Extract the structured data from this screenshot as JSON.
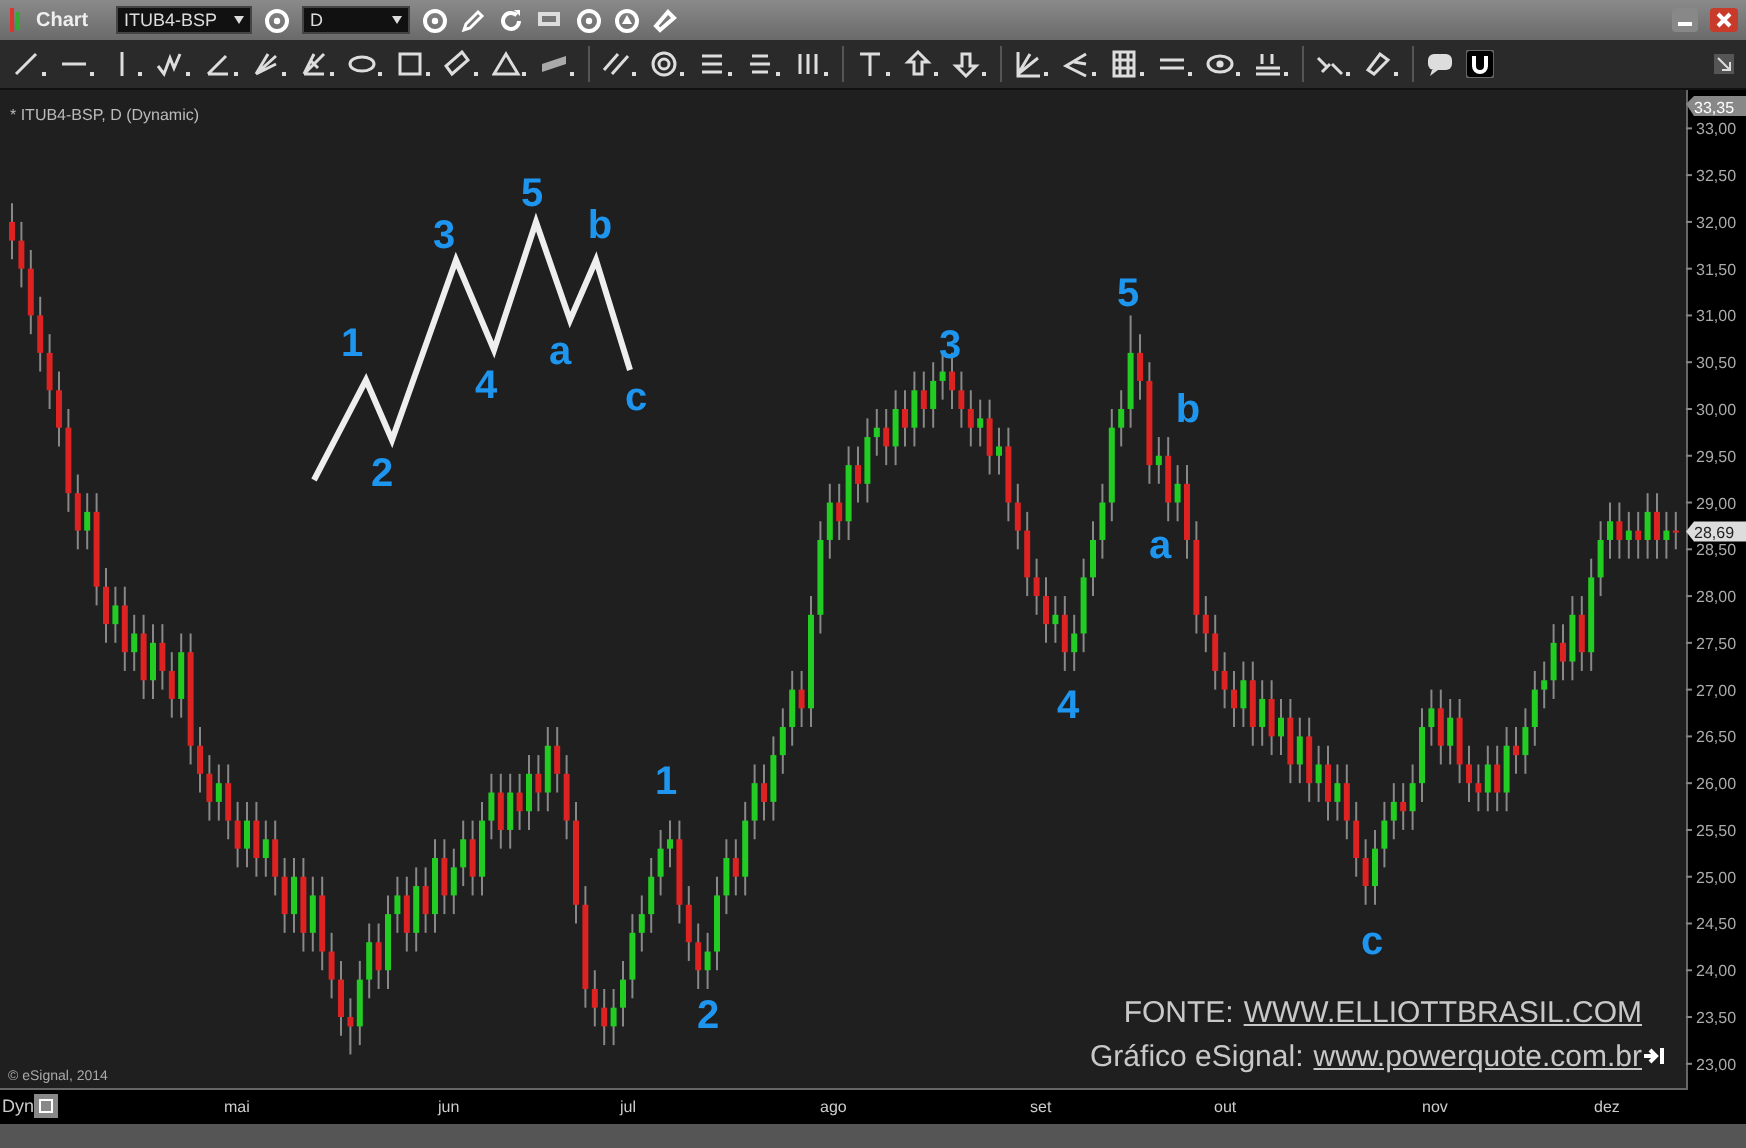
{
  "window": {
    "title": "Chart"
  },
  "toolbar": {
    "symbol": "ITUB4-BSP",
    "interval": "D"
  },
  "chart": {
    "legend": "* ITUB4-BSP, D (Dynamic)",
    "top_price": "33,35",
    "last_price": "28,69",
    "x_axis_labels": [
      "mai",
      "jun",
      "jul",
      "ago",
      "set",
      "out",
      "nov",
      "dez"
    ],
    "chart_data": {
      "type": "candlestick",
      "ylim": [
        22.72,
        33.41
      ],
      "yticks": [
        {
          "value": 33,
          "label": "33,00"
        },
        {
          "value": 32.5,
          "label": "32,50"
        },
        {
          "value": 32,
          "label": "32,00"
        },
        {
          "value": 31.5,
          "label": "31,50"
        },
        {
          "value": 31,
          "label": "31,00"
        },
        {
          "value": 30.5,
          "label": "30,50"
        },
        {
          "value": 30,
          "label": "30,00"
        },
        {
          "value": 29.5,
          "label": "29,50"
        },
        {
          "value": 29,
          "label": "29,00"
        },
        {
          "value": 28.5,
          "label": "28,50"
        },
        {
          "value": 28,
          "label": "28,00"
        },
        {
          "value": 27.5,
          "label": "27,50"
        },
        {
          "value": 27,
          "label": "27,00"
        },
        {
          "value": 26.5,
          "label": "26,50"
        },
        {
          "value": 26,
          "label": "26,00"
        },
        {
          "value": 25.5,
          "label": "25,50"
        },
        {
          "value": 25,
          "label": "25,00"
        },
        {
          "value": 24.5,
          "label": "24,50"
        },
        {
          "value": 24,
          "label": "24,00"
        },
        {
          "value": 23.5,
          "label": "23,50"
        },
        {
          "value": 23,
          "label": "23,00"
        }
      ],
      "ohlc": [
        [
          32.0,
          32.2,
          31.6,
          31.8
        ],
        [
          31.8,
          32.0,
          31.3,
          31.5
        ],
        [
          31.5,
          31.7,
          30.8,
          31.0
        ],
        [
          31.0,
          31.2,
          30.4,
          30.6
        ],
        [
          30.6,
          30.8,
          30.0,
          30.2
        ],
        [
          30.2,
          30.4,
          29.6,
          29.8
        ],
        [
          29.8,
          30.0,
          28.9,
          29.1
        ],
        [
          29.1,
          29.3,
          28.5,
          28.7
        ],
        [
          28.7,
          29.1,
          28.5,
          28.9
        ],
        [
          28.9,
          29.1,
          27.9,
          28.1
        ],
        [
          28.1,
          28.3,
          27.5,
          27.7
        ],
        [
          27.7,
          28.1,
          27.5,
          27.9
        ],
        [
          27.9,
          28.1,
          27.2,
          27.4
        ],
        [
          27.4,
          27.8,
          27.2,
          27.6
        ],
        [
          27.6,
          27.8,
          26.9,
          27.1
        ],
        [
          27.1,
          27.7,
          26.9,
          27.5
        ],
        [
          27.5,
          27.7,
          27.0,
          27.2
        ],
        [
          27.2,
          27.4,
          26.7,
          26.9
        ],
        [
          26.9,
          27.6,
          26.7,
          27.4
        ],
        [
          27.4,
          27.6,
          26.2,
          26.4
        ],
        [
          26.4,
          26.6,
          25.9,
          26.1
        ],
        [
          26.1,
          26.3,
          25.6,
          25.8
        ],
        [
          25.8,
          26.2,
          25.6,
          26.0
        ],
        [
          26.0,
          26.2,
          25.4,
          25.6
        ],
        [
          25.6,
          25.8,
          25.1,
          25.3
        ],
        [
          25.3,
          25.8,
          25.1,
          25.6
        ],
        [
          25.6,
          25.8,
          25.0,
          25.2
        ],
        [
          25.2,
          25.6,
          25.0,
          25.4
        ],
        [
          25.4,
          25.6,
          24.8,
          25.0
        ],
        [
          25.0,
          25.2,
          24.4,
          24.6
        ],
        [
          24.6,
          25.2,
          24.4,
          25.0
        ],
        [
          25.0,
          25.2,
          24.2,
          24.4
        ],
        [
          24.4,
          25.0,
          24.2,
          24.8
        ],
        [
          24.8,
          25.0,
          24.0,
          24.2
        ],
        [
          24.2,
          24.4,
          23.7,
          23.9
        ],
        [
          23.9,
          24.1,
          23.3,
          23.5
        ],
        [
          23.5,
          23.7,
          23.1,
          23.4
        ],
        [
          23.4,
          24.1,
          23.2,
          23.9
        ],
        [
          23.9,
          24.5,
          23.7,
          24.3
        ],
        [
          24.3,
          24.5,
          23.8,
          24.0
        ],
        [
          24.0,
          24.8,
          23.8,
          24.6
        ],
        [
          24.6,
          25.0,
          24.4,
          24.8
        ],
        [
          24.8,
          25.0,
          24.2,
          24.4
        ],
        [
          24.4,
          25.1,
          24.2,
          24.9
        ],
        [
          24.9,
          25.1,
          24.4,
          24.6
        ],
        [
          24.6,
          25.4,
          24.4,
          25.2
        ],
        [
          25.2,
          25.4,
          24.6,
          24.8
        ],
        [
          24.8,
          25.3,
          24.6,
          25.1
        ],
        [
          25.1,
          25.6,
          24.9,
          25.4
        ],
        [
          25.4,
          25.6,
          24.8,
          25.0
        ],
        [
          25.0,
          25.8,
          24.8,
          25.6
        ],
        [
          25.6,
          26.1,
          25.4,
          25.9
        ],
        [
          25.9,
          26.1,
          25.3,
          25.5
        ],
        [
          25.5,
          26.1,
          25.3,
          25.9
        ],
        [
          25.9,
          26.1,
          25.5,
          25.7
        ],
        [
          25.7,
          26.3,
          25.5,
          26.1
        ],
        [
          26.1,
          26.3,
          25.7,
          25.9
        ],
        [
          25.9,
          26.6,
          25.7,
          26.4
        ],
        [
          26.4,
          26.6,
          25.9,
          26.1
        ],
        [
          26.1,
          26.3,
          25.4,
          25.6
        ],
        [
          25.6,
          25.8,
          24.5,
          24.7
        ],
        [
          24.7,
          24.9,
          23.6,
          23.8
        ],
        [
          23.8,
          24.0,
          23.4,
          23.6
        ],
        [
          23.6,
          23.8,
          23.2,
          23.4
        ],
        [
          23.4,
          23.8,
          23.2,
          23.6
        ],
        [
          23.6,
          24.1,
          23.4,
          23.9
        ],
        [
          23.9,
          24.6,
          23.7,
          24.4
        ],
        [
          24.4,
          24.8,
          24.2,
          24.6
        ],
        [
          24.6,
          25.2,
          24.4,
          25.0
        ],
        [
          25.0,
          25.5,
          24.8,
          25.3
        ],
        [
          25.3,
          25.6,
          25.1,
          25.4
        ],
        [
          25.4,
          25.6,
          24.5,
          24.7
        ],
        [
          24.7,
          24.9,
          24.1,
          24.3
        ],
        [
          24.3,
          24.5,
          23.8,
          24.0
        ],
        [
          24.0,
          24.4,
          23.8,
          24.2
        ],
        [
          24.2,
          25.0,
          24.0,
          24.8
        ],
        [
          24.8,
          25.4,
          24.6,
          25.2
        ],
        [
          25.2,
          25.4,
          24.8,
          25.0
        ],
        [
          25.0,
          25.8,
          24.8,
          25.6
        ],
        [
          25.6,
          26.2,
          25.4,
          26.0
        ],
        [
          26.0,
          26.2,
          25.6,
          25.8
        ],
        [
          25.8,
          26.5,
          25.6,
          26.3
        ],
        [
          26.3,
          26.8,
          26.1,
          26.6
        ],
        [
          26.6,
          27.2,
          26.4,
          27.0
        ],
        [
          27.0,
          27.2,
          26.6,
          26.8
        ],
        [
          26.8,
          28.0,
          26.6,
          27.8
        ],
        [
          27.8,
          28.8,
          27.6,
          28.6
        ],
        [
          28.6,
          29.2,
          28.4,
          29.0
        ],
        [
          29.0,
          29.2,
          28.6,
          28.8
        ],
        [
          28.8,
          29.6,
          28.6,
          29.4
        ],
        [
          29.4,
          29.6,
          29.0,
          29.2
        ],
        [
          29.2,
          29.9,
          29.0,
          29.7
        ],
        [
          29.7,
          30.0,
          29.5,
          29.8
        ],
        [
          29.8,
          30.0,
          29.4,
          29.6
        ],
        [
          29.6,
          30.2,
          29.4,
          30.0
        ],
        [
          30.0,
          30.2,
          29.6,
          29.8
        ],
        [
          29.8,
          30.4,
          29.6,
          30.2
        ],
        [
          30.2,
          30.4,
          29.8,
          30.0
        ],
        [
          30.0,
          30.5,
          29.8,
          30.3
        ],
        [
          30.3,
          30.6,
          30.1,
          30.4
        ],
        [
          30.4,
          30.6,
          30.0,
          30.2
        ],
        [
          30.2,
          30.4,
          29.8,
          30.0
        ],
        [
          30.0,
          30.2,
          29.6,
          29.8
        ],
        [
          29.8,
          30.1,
          29.6,
          29.9
        ],
        [
          29.9,
          30.1,
          29.3,
          29.5
        ],
        [
          29.5,
          29.8,
          29.3,
          29.6
        ],
        [
          29.6,
          29.8,
          28.8,
          29.0
        ],
        [
          29.0,
          29.2,
          28.5,
          28.7
        ],
        [
          28.7,
          28.9,
          28.0,
          28.2
        ],
        [
          28.2,
          28.4,
          27.8,
          28.0
        ],
        [
          28.0,
          28.2,
          27.5,
          27.7
        ],
        [
          27.7,
          28.0,
          27.5,
          27.8
        ],
        [
          27.8,
          28.0,
          27.2,
          27.4
        ],
        [
          27.4,
          27.8,
          27.2,
          27.6
        ],
        [
          27.6,
          28.4,
          27.4,
          28.2
        ],
        [
          28.2,
          28.8,
          28.0,
          28.6
        ],
        [
          28.6,
          29.2,
          28.4,
          29.0
        ],
        [
          29.0,
          30.0,
          28.8,
          29.8
        ],
        [
          29.8,
          30.2,
          29.6,
          30.0
        ],
        [
          30.0,
          31.0,
          29.8,
          30.6
        ],
        [
          30.6,
          30.8,
          30.1,
          30.3
        ],
        [
          30.3,
          30.5,
          29.2,
          29.4
        ],
        [
          29.4,
          29.7,
          29.2,
          29.5
        ],
        [
          29.5,
          29.7,
          28.8,
          29.0
        ],
        [
          29.0,
          29.4,
          28.8,
          29.2
        ],
        [
          29.2,
          29.4,
          28.4,
          28.6
        ],
        [
          28.6,
          28.8,
          27.6,
          27.8
        ],
        [
          27.8,
          28.0,
          27.4,
          27.6
        ],
        [
          27.6,
          27.8,
          27.0,
          27.2
        ],
        [
          27.2,
          27.4,
          26.8,
          27.0
        ],
        [
          27.0,
          27.2,
          26.6,
          26.8
        ],
        [
          26.8,
          27.3,
          26.6,
          27.1
        ],
        [
          27.1,
          27.3,
          26.4,
          26.6
        ],
        [
          26.6,
          27.1,
          26.4,
          26.9
        ],
        [
          26.9,
          27.1,
          26.3,
          26.5
        ],
        [
          26.5,
          26.9,
          26.3,
          26.7
        ],
        [
          26.7,
          26.9,
          26.0,
          26.2
        ],
        [
          26.2,
          26.7,
          26.0,
          26.5
        ],
        [
          26.5,
          26.7,
          25.8,
          26.0
        ],
        [
          26.0,
          26.4,
          25.8,
          26.2
        ],
        [
          26.2,
          26.4,
          25.6,
          25.8
        ],
        [
          25.8,
          26.2,
          25.6,
          26.0
        ],
        [
          26.0,
          26.2,
          25.4,
          25.6
        ],
        [
          25.6,
          25.8,
          25.0,
          25.2
        ],
        [
          25.2,
          25.4,
          24.7,
          24.9
        ],
        [
          24.9,
          25.5,
          24.7,
          25.3
        ],
        [
          25.3,
          25.8,
          25.1,
          25.6
        ],
        [
          25.6,
          26.0,
          25.4,
          25.8
        ],
        [
          25.8,
          26.0,
          25.5,
          25.7
        ],
        [
          25.7,
          26.2,
          25.5,
          26.0
        ],
        [
          26.0,
          26.8,
          25.8,
          26.6
        ],
        [
          26.6,
          27.0,
          26.4,
          26.8
        ],
        [
          26.8,
          27.0,
          26.2,
          26.4
        ],
        [
          26.4,
          26.9,
          26.2,
          26.7
        ],
        [
          26.7,
          26.9,
          26.0,
          26.2
        ],
        [
          26.2,
          26.4,
          25.8,
          26.0
        ],
        [
          26.0,
          26.2,
          25.7,
          25.9
        ],
        [
          25.9,
          26.4,
          25.7,
          26.2
        ],
        [
          26.2,
          26.4,
          25.7,
          25.9
        ],
        [
          25.9,
          26.6,
          25.7,
          26.4
        ],
        [
          26.4,
          26.6,
          26.1,
          26.3
        ],
        [
          26.3,
          26.8,
          26.1,
          26.6
        ],
        [
          26.6,
          27.2,
          26.4,
          27.0
        ],
        [
          27.0,
          27.3,
          26.8,
          27.1
        ],
        [
          27.1,
          27.7,
          26.9,
          27.5
        ],
        [
          27.5,
          27.7,
          27.1,
          27.3
        ],
        [
          27.3,
          28.0,
          27.1,
          27.8
        ],
        [
          27.8,
          28.0,
          27.2,
          27.4
        ],
        [
          27.4,
          28.4,
          27.2,
          28.2
        ],
        [
          28.2,
          28.8,
          28.0,
          28.6
        ],
        [
          28.6,
          29.0,
          28.4,
          28.8
        ],
        [
          28.8,
          29.0,
          28.4,
          28.6
        ],
        [
          28.6,
          28.9,
          28.4,
          28.7
        ],
        [
          28.7,
          28.9,
          28.4,
          28.6
        ],
        [
          28.6,
          29.1,
          28.4,
          28.9
        ],
        [
          28.9,
          29.1,
          28.4,
          28.6
        ],
        [
          28.6,
          28.9,
          28.4,
          28.7
        ],
        [
          28.7,
          28.9,
          28.5,
          28.69
        ]
      ]
    },
    "wave_diagram_labels": [
      "1",
      "2",
      "3",
      "4",
      "5",
      "a",
      "b",
      "c"
    ],
    "wave_labels": [
      "1",
      "2",
      "3",
      "4",
      "5",
      "a",
      "b",
      "c"
    ],
    "source": {
      "prefix": "FONTE:",
      "link": "WWW.ELLIOTTBRASIL.COM"
    },
    "credit": {
      "prefix": "Gráfico eSignal:",
      "link": "www.powerquote.com.br"
    },
    "copyright": "© eSignal, 2014"
  },
  "status": {
    "mode": "Dyn"
  }
}
